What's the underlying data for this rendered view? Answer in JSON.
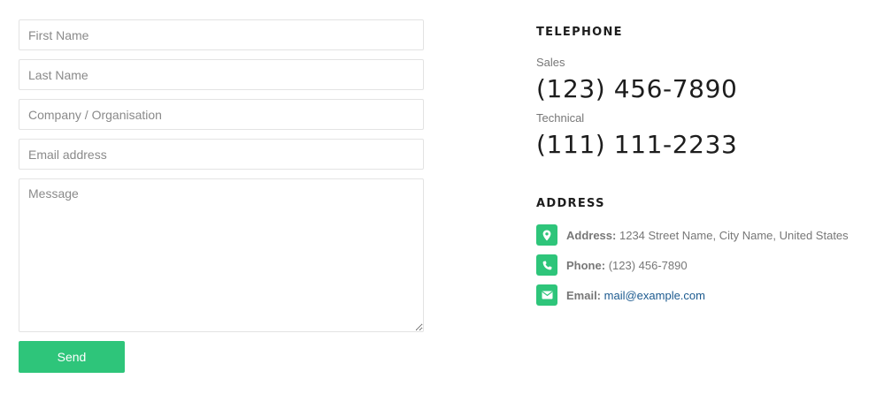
{
  "form": {
    "first_name_placeholder": "First Name",
    "last_name_placeholder": "Last Name",
    "company_placeholder": "Company / Organisation",
    "email_placeholder": "Email address",
    "message_placeholder": "Message",
    "send_label": "Send"
  },
  "telephone": {
    "heading": "TELEPHONE",
    "sales_label": "Sales",
    "sales_number": "(123) 456-7890",
    "technical_label": "Technical",
    "technical_number": "(111) 111-2233"
  },
  "address": {
    "heading": "ADDRESS",
    "items": [
      {
        "icon": "map-marker-icon",
        "key": "Address:",
        "value": "1234 Street Name, City Name, United States"
      },
      {
        "icon": "phone-icon",
        "key": "Phone:",
        "value": "(123) 456-7890"
      },
      {
        "icon": "envelope-icon",
        "key": "Email:",
        "value": "mail@example.com"
      }
    ]
  },
  "colors": {
    "accent": "#2ec57a",
    "link": "#1c5a8f",
    "heading": "#1d1d1d",
    "muted": "#777777"
  }
}
